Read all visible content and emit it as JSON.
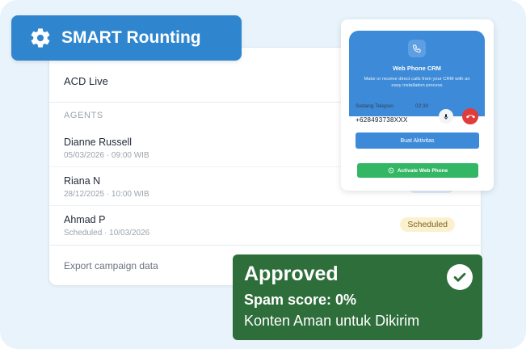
{
  "smart_routing": {
    "label": "SMART Rounting",
    "icon": "gear-icon"
  },
  "acd": {
    "title": "ACD Live",
    "section_label": "AGENTS",
    "agents": [
      {
        "name": "Dianne Russell",
        "detail": "05/03/2026 · 09:00 WIB",
        "badge": ""
      },
      {
        "name": "Riana N",
        "detail": "28/12/2025 · 10:00 WIB",
        "badge": "Wrap-up"
      },
      {
        "name": "Ahmad P",
        "detail": "Scheduled · 10/03/2026",
        "badge": "Scheduled"
      }
    ],
    "footer": "Export campaign data"
  },
  "web_phone": {
    "title": "Web Phone CRM",
    "description": "Make or receive direct calls from your CRM with an easy installation process",
    "call_label": "Sedang Telepon",
    "call_time": "02:30",
    "phone_number": "+628493738XXX",
    "activity_button": "Buat Aktivitas",
    "whatsapp_button": "Activate Web Phone",
    "icons": {
      "header": "phone-icon",
      "mic": "microphone-icon",
      "hangup": "hangup-icon",
      "whatsapp": "whatsapp-icon"
    }
  },
  "approval": {
    "title": "Approved",
    "spam_score": "Spam score: 0%",
    "safe_text": "Konten Aman untuk Dikirim",
    "icon": "check-icon"
  },
  "colors": {
    "brand_blue": "#2f86cf",
    "approved_green": "#2e6e3a",
    "whatsapp_green": "#34b765",
    "hangup_red": "#e23b3b"
  }
}
